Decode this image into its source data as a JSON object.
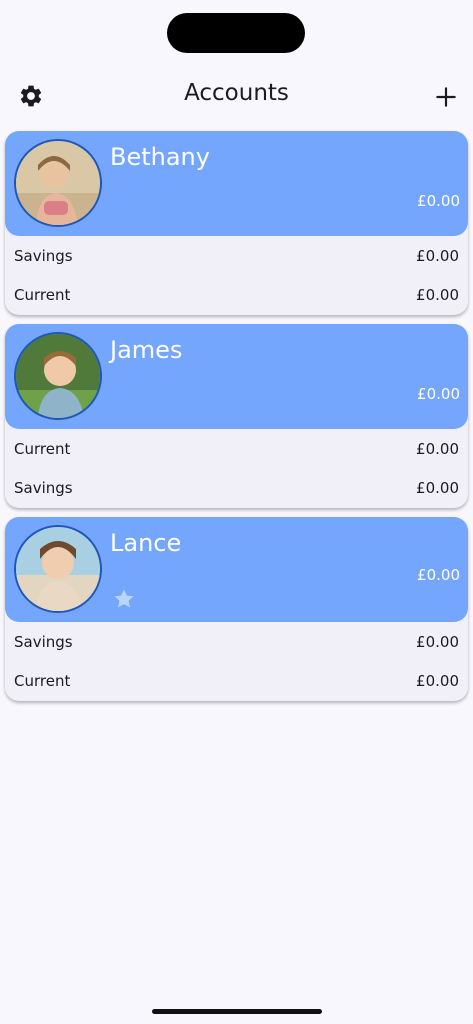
{
  "header": {
    "title": "Accounts",
    "settings_icon": "gear-icon",
    "add_icon": "plus-icon"
  },
  "colors": {
    "accent": "#74a6fd",
    "background": "#f8f7fd",
    "card": "#f1f0f8",
    "avatar_border": "#1f57b3"
  },
  "people": [
    {
      "name": "Bethany",
      "total": "£0.00",
      "favorite": false,
      "accounts": [
        {
          "label": "Savings",
          "amount": "£0.00"
        },
        {
          "label": "Current",
          "amount": "£0.00"
        }
      ]
    },
    {
      "name": "James",
      "total": "£0.00",
      "favorite": false,
      "accounts": [
        {
          "label": "Current",
          "amount": "£0.00"
        },
        {
          "label": "Savings",
          "amount": "£0.00"
        }
      ]
    },
    {
      "name": "Lance",
      "total": "£0.00",
      "favorite": true,
      "accounts": [
        {
          "label": "Savings",
          "amount": "£0.00"
        },
        {
          "label": "Current",
          "amount": "£0.00"
        }
      ]
    }
  ]
}
